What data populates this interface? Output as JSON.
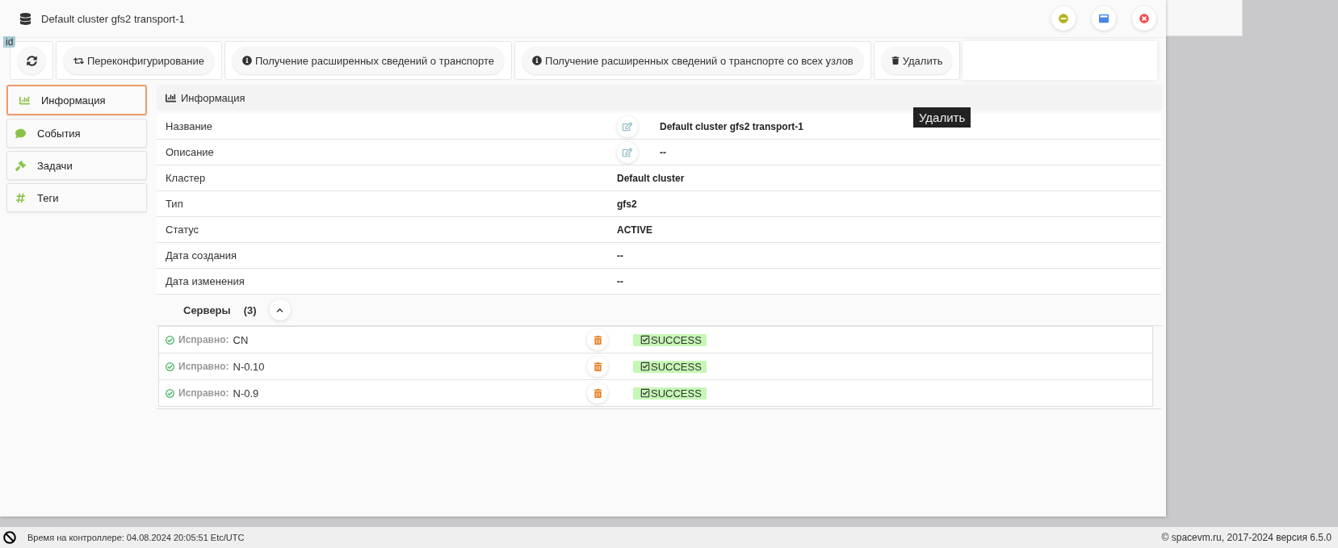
{
  "window": {
    "title": "Default cluster gfs2 transport-1"
  },
  "id_badge": "id",
  "toolbar": [
    {
      "kind": "refresh"
    },
    {
      "kind": "reconfigure",
      "label": "Переконфигурирование"
    },
    {
      "kind": "info",
      "label": "Получение расширенных сведений о транспорте"
    },
    {
      "kind": "info",
      "label": "Получение расширенных сведений о транспорте со всех узлов"
    },
    {
      "kind": "delete",
      "label": "Удалить"
    }
  ],
  "tooltip": "Удалить",
  "sidebar": {
    "items": [
      {
        "kind": "info",
        "label": "Информация",
        "selected": true
      },
      {
        "kind": "events",
        "label": "События",
        "selected": false
      },
      {
        "kind": "tasks",
        "label": "Задачи",
        "selected": false
      },
      {
        "kind": "tags",
        "label": "Теги",
        "selected": false
      }
    ]
  },
  "panel": {
    "title": "Информация",
    "fields": [
      {
        "label": "Название",
        "value": "Default cluster gfs2 transport-1",
        "editable": true
      },
      {
        "label": "Описание",
        "value": "--",
        "editable": true
      },
      {
        "label": "Кластер",
        "value": "Default cluster",
        "editable": false
      },
      {
        "label": "Тип",
        "value": "gfs2",
        "editable": false
      },
      {
        "label": "Статус",
        "value": "ACTIVE",
        "editable": false
      },
      {
        "label": "Дата создания",
        "value": "--",
        "editable": false
      },
      {
        "label": "Дата изменения",
        "value": "--",
        "editable": false
      }
    ],
    "servers": {
      "title": "Серверы",
      "count": "(3)",
      "expanded": true,
      "rows": [
        {
          "status": "Исправно:",
          "name": "CN",
          "result": "SUCCESS"
        },
        {
          "status": "Исправно:",
          "name": "N-0.10",
          "result": "SUCCESS"
        },
        {
          "status": "Исправно:",
          "name": "N-0.9",
          "result": "SUCCESS"
        }
      ]
    }
  },
  "status_bar": {
    "time": "Время на контроллере: 04.08.2024 20:05:51 Etc/UTC",
    "copyright": "© spacevm.ru, 2017-2024 версия 6.5.0"
  }
}
